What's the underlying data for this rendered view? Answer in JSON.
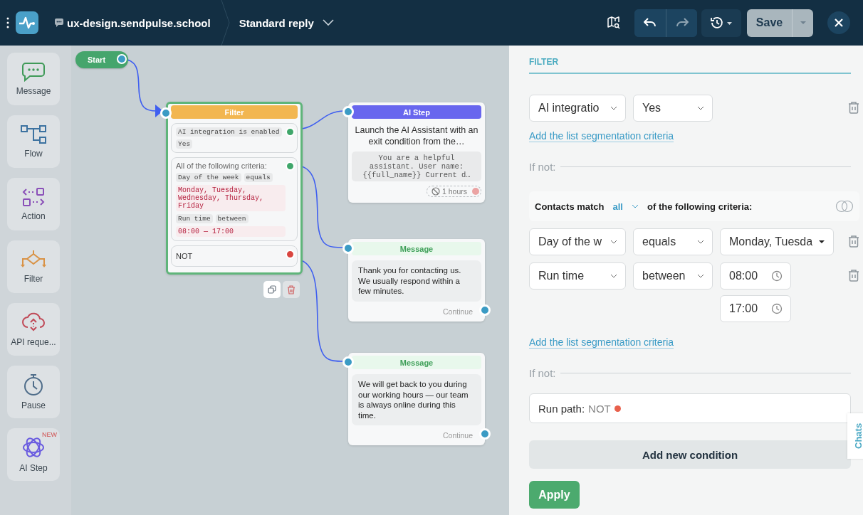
{
  "header": {
    "workspace": "ux-design.sendpulse.school",
    "flow_name": "Standard reply",
    "save_label": "Save"
  },
  "sidebar": {
    "items": [
      {
        "kind": "message",
        "label": "Message"
      },
      {
        "kind": "flow",
        "label": "Flow"
      },
      {
        "kind": "action",
        "label": "Action"
      },
      {
        "kind": "filter",
        "label": "Filter"
      },
      {
        "kind": "api",
        "label": "API reque..."
      },
      {
        "kind": "pause",
        "label": "Pause"
      },
      {
        "kind": "ai",
        "label": "AI Step",
        "badge": "NEW"
      }
    ]
  },
  "canvas": {
    "start": {
      "label": "Start"
    },
    "filter_node": {
      "title": "Filter",
      "conditions": [
        {
          "kind": "single",
          "tags": [
            "AI integration is enabled",
            "Yes"
          ],
          "color": "#3fa66a"
        },
        {
          "kind": "group",
          "heading": "All of the following criteria:",
          "rules": [
            {
              "field": "Day of the week",
              "operator": "equals",
              "value": "Monday, Tuesday, Wednesday, Thursday, Friday"
            },
            {
              "field": "Run time",
              "operator": "between",
              "value": "08:00 — 17:00"
            }
          ],
          "color": "#3fa66a"
        },
        {
          "kind": "not",
          "label": "NOT",
          "color": "#d9453f"
        }
      ]
    },
    "ai_node": {
      "title": "AI Step",
      "description": "Launch the AI Assistant with an exit condition from the…",
      "prompt": "You are a helpful assistant. User name: {{full_name}} Current d…",
      "timeout": "1 hours"
    },
    "message_nodes": [
      {
        "title": "Message",
        "text": "Thank you for contacting us. We usually respond within a few minutes.",
        "action": "Continue"
      },
      {
        "title": "Message",
        "text": "We will get back to you during our working hours — our team is always online during this time.",
        "action": "Continue"
      }
    ]
  },
  "panel": {
    "title": "FILTER",
    "condition": {
      "field": "AI integratio",
      "value": "Yes"
    },
    "add_links": [
      "Add the list segmentation criteria",
      "Add the list segmentation criteria"
    ],
    "if_not_labels": [
      "If not:",
      "If not:"
    ],
    "group": {
      "prefix": "Contacts match",
      "match": "all",
      "suffix": "of the following criteria:",
      "rules": [
        {
          "kind": "multi",
          "field": "Day of the w",
          "operator": "equals",
          "value": "Monday, Tuesda"
        },
        {
          "kind": "time",
          "field": "Run time",
          "operator": "between",
          "times": [
            "08:00",
            "17:00"
          ]
        }
      ]
    },
    "run_path": {
      "label": "Run path:",
      "value": "NOT",
      "color": "#e8604c"
    },
    "add_condition": "Add new condition",
    "apply": "Apply",
    "chats_tab": "Chats"
  }
}
